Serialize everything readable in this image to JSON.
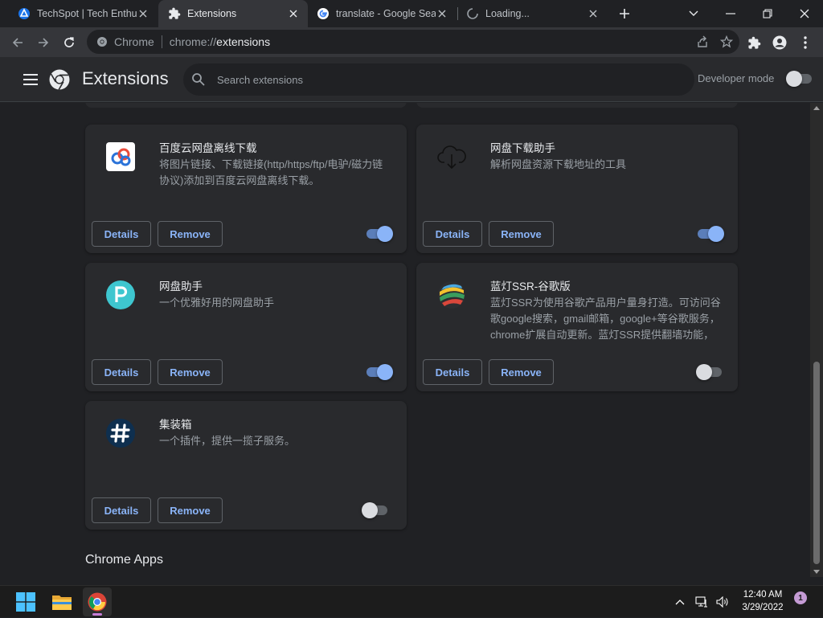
{
  "tabs": [
    {
      "title": "TechSpot | Tech Enthusiasts",
      "favicon": "techspot-icon",
      "active": false
    },
    {
      "title": "Extensions",
      "favicon": "puzzle-icon",
      "active": true
    },
    {
      "title": "translate - Google Search",
      "favicon": "google-icon",
      "active": false
    },
    {
      "title": "Loading...",
      "favicon": "loading-spinner-icon",
      "active": false
    }
  ],
  "omnibox": {
    "site_label": "Chrome",
    "url_scheme": "chrome://",
    "url_path": "extensions"
  },
  "header": {
    "title": "Extensions",
    "search_placeholder": "Search extensions",
    "developer_mode_label": "Developer mode",
    "developer_mode_on": false
  },
  "extensions": [
    {
      "name": "百度云网盘离线下载",
      "description": "将图片链接、下载链接(http/https/ftp/电驴/磁力链协议)添加到百度云网盘离线下载。",
      "icon": "baidu-cloud-icon",
      "enabled": true,
      "details_label": "Details",
      "remove_label": "Remove"
    },
    {
      "name": "网盘下载助手",
      "description": "解析网盘资源下载地址的工具",
      "icon": "cloud-download-icon",
      "enabled": true,
      "details_label": "Details",
      "remove_label": "Remove"
    },
    {
      "name": "网盘助手",
      "description": "一个优雅好用的网盘助手",
      "icon": "letter-p-icon",
      "enabled": true,
      "details_label": "Details",
      "remove_label": "Remove"
    },
    {
      "name": "蓝灯SSR-谷歌版",
      "description": "蓝灯SSR为使用谷歌产品用户量身打造。可访问谷歌google搜索，gmail邮箱，google+等谷歌服务，chrome扩展自动更新。蓝灯SSR提供翻墙功能，",
      "icon": "lantern-ball-icon",
      "enabled": false,
      "details_label": "Details",
      "remove_label": "Remove"
    },
    {
      "name": "集装箱",
      "description": "一个插件，提供一揽子服务。",
      "icon": "hash-icon",
      "enabled": false,
      "details_label": "Details",
      "remove_label": "Remove"
    }
  ],
  "sections": {
    "chrome_apps": "Chrome Apps"
  },
  "taskbar": {
    "time": "12:40 AM",
    "date": "3/29/2022",
    "notification_count": "1"
  },
  "colors": {
    "accent": "#8ab4f8",
    "background": "#202124",
    "card": "#292a2d"
  }
}
